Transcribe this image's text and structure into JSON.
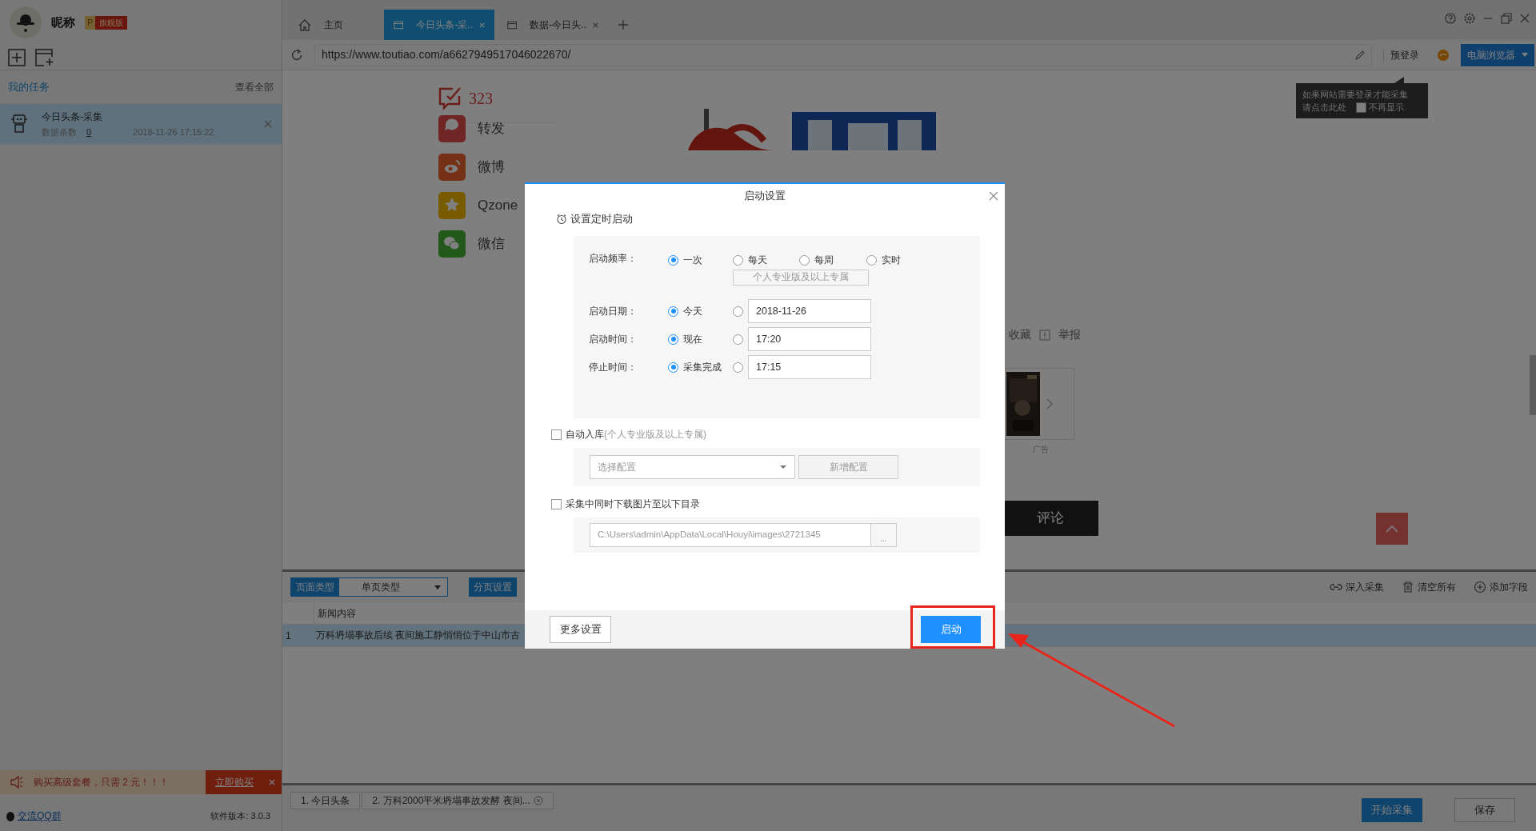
{
  "user": {
    "nickname": "昵称",
    "badge_letter": "P",
    "badge": "旗舰版"
  },
  "sidebar": {
    "section_title": "我的任务",
    "view_all": "查看全部",
    "tasks": [
      {
        "name": "今日头条-采集",
        "count_label": "数据条数",
        "count": "0",
        "time": "2018-11-26 17:15:22",
        "selected": true
      }
    ]
  },
  "promo": {
    "text": "购买高级套餐，只需 2 元！！！",
    "button": "立即购买"
  },
  "footer": {
    "qq_group": "交流QQ群",
    "version": "软件版本: 3.0.3"
  },
  "tabs": [
    {
      "kind": "home",
      "label": "主页",
      "selected": false
    },
    {
      "kind": "page",
      "label": "今日头条-采..",
      "selected": true
    },
    {
      "kind": "page",
      "label": "数据-今日头..",
      "selected": false
    }
  ],
  "address_bar": {
    "url": "https://www.toutiao.com/a6627949517046022670/",
    "pre_login": "预登录",
    "browser_mode": "电脑浏览器"
  },
  "tooltip": {
    "lines": [
      "如果网站需要登录才能采集",
      "请点击此处"
    ],
    "checkbox_label": "不再显示",
    "checked": false
  },
  "web_page": {
    "comment_count": "323",
    "share": [
      {
        "kind": "repost",
        "label": "转发"
      },
      {
        "kind": "weibo",
        "label": "微博"
      },
      {
        "kind": "qzone",
        "label": "Qzone"
      },
      {
        "kind": "wechat",
        "label": "微信"
      }
    ],
    "actions": [
      {
        "kind": "star",
        "label": "收藏"
      },
      {
        "kind": "report",
        "label": "举报"
      }
    ],
    "ad_label": "广告",
    "comment_button": "评论"
  },
  "bottom_panel": {
    "page_type_label": "页面类型",
    "page_type": "单页类型",
    "pagination": "分页设置",
    "tools": [
      {
        "kind": "link",
        "label": "深入采集"
      },
      {
        "kind": "trash",
        "label": "清空所有"
      },
      {
        "kind": "add",
        "label": "添加字段"
      }
    ],
    "columns": [
      "新闻内容"
    ],
    "rows": [
      {
        "index": "1",
        "cells": [
          "万科坍塌事故后续 夜间施工静悄悄位于中山市古"
        ],
        "selected": true
      }
    ]
  },
  "result_tabs": [
    {
      "label": "1. 今日头条",
      "closable": false
    },
    {
      "label": "2. 万科2000平米坍塌事故发酵 夜间...",
      "closable": true
    }
  ],
  "actions": {
    "start": "开始采集",
    "save": "保存"
  },
  "dialog": {
    "title": "启动设置",
    "schedule_title": "设置定时启动",
    "frequency": {
      "label": "启动频率：",
      "options": [
        {
          "label": "一次",
          "selected": true
        },
        {
          "label": "每天",
          "selected": false
        },
        {
          "label": "每周",
          "selected": false
        },
        {
          "label": "实时",
          "selected": false
        }
      ],
      "pro_note": "个人专业版及以上专属"
    },
    "schedule_rows": [
      {
        "label": "启动日期：",
        "default": "今天",
        "default_selected": true,
        "custom_selected": false,
        "value": "2018-11-26"
      },
      {
        "label": "启动时间：",
        "default": "现在",
        "default_selected": true,
        "custom_selected": false,
        "value": "17:20"
      },
      {
        "label": "停止时间：",
        "default": "采集完成",
        "default_selected": true,
        "custom_selected": false,
        "value": "17:15"
      }
    ],
    "auto_import": {
      "label": "自动入库",
      "note": "(个人专业版及以上专属)",
      "checked": false,
      "select_placeholder": "选择配置",
      "new_button": "新增配置"
    },
    "download_images": {
      "label": "采集中同时下载图片至以下目录",
      "checked": false,
      "path": "C:\\Users\\admin\\AppData\\Local\\Houyi\\images\\2721345",
      "browse": "..."
    },
    "more_button": "更多设置",
    "start_button": "启动"
  }
}
